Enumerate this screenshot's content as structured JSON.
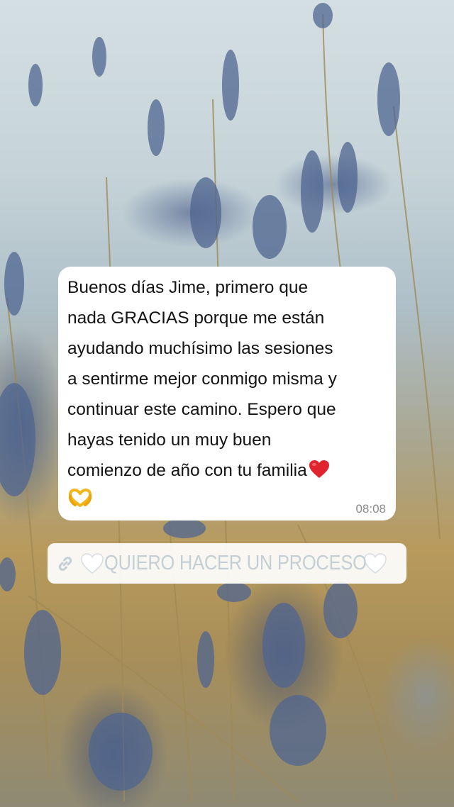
{
  "message": {
    "text": "Buenos días Jime, primero que\nnada GRACIAS porque me están\nayudando muchísimo las sesiones\na sentirme mejor conmigo misma y\ncontinuar este camino. Espero que\nhayas tenido un muy buen\ncomienzo de año con tu familia",
    "time": "08:08",
    "emojis": [
      "red-heart",
      "heart-hands"
    ]
  },
  "link": {
    "text": "QUIERO HACER UN PROCESO",
    "icon": "link-icon",
    "decorations": [
      "white-heart",
      "white-heart"
    ]
  },
  "colors": {
    "bubble_background": "#ffffff",
    "link_text": "#c3cfd4",
    "time_text": "#8a8a8a"
  }
}
